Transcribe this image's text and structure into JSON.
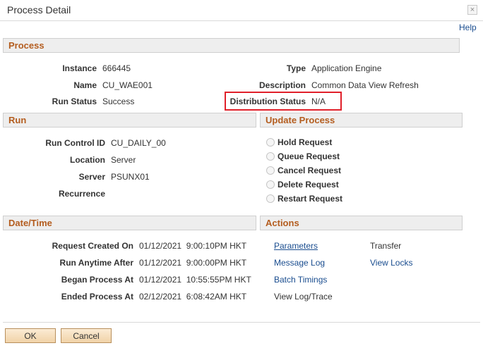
{
  "window": {
    "title": "Process Detail",
    "close_glyph": "×",
    "help": "Help"
  },
  "process": {
    "header": "Process",
    "instance_label": "Instance",
    "instance_value": "666445",
    "name_label": "Name",
    "name_value": "CU_WAE001",
    "run_status_label": "Run Status",
    "run_status_value": "Success",
    "type_label": "Type",
    "type_value": "Application Engine",
    "description_label": "Description",
    "description_value": "Common Data View Refresh",
    "distribution_status_label": "Distribution Status",
    "distribution_status_value": "N/A"
  },
  "run": {
    "header": "Run",
    "run_control_label": "Run Control ID",
    "run_control_value": "CU_DAILY_00",
    "location_label": "Location",
    "location_value": "Server",
    "server_label": "Server",
    "server_value": "PSUNX01",
    "recurrence_label": "Recurrence"
  },
  "update_process": {
    "header": "Update Process",
    "options": [
      "Hold Request",
      "Queue Request",
      "Cancel Request",
      "Delete Request",
      "Restart Request"
    ]
  },
  "datetime": {
    "header": "Date/Time",
    "created_label": "Request Created On",
    "created_value": "01/12/2021  9:00:10PM HKT",
    "anytime_label": "Run Anytime After",
    "anytime_value": "01/12/2021  9:00:00PM HKT",
    "began_label": "Began Process At",
    "began_value": "01/12/2021  10:55:55PM HKT",
    "ended_label": "Ended Process At",
    "ended_value": "02/12/2021  6:08:42AM HKT"
  },
  "actions": {
    "header": "Actions",
    "parameters": "Parameters",
    "transfer": "Transfer",
    "message_log": "Message Log",
    "view_locks": "View Locks",
    "batch_timings": "Batch Timings",
    "view_log_trace": "View Log/Trace"
  },
  "buttons": {
    "ok": "OK",
    "cancel": "Cancel"
  },
  "colors": {
    "section_header_text": "#b45d1f",
    "link": "#1a4d8f",
    "highlight_border": "#e0202a",
    "button_border": "#b88f5c"
  }
}
